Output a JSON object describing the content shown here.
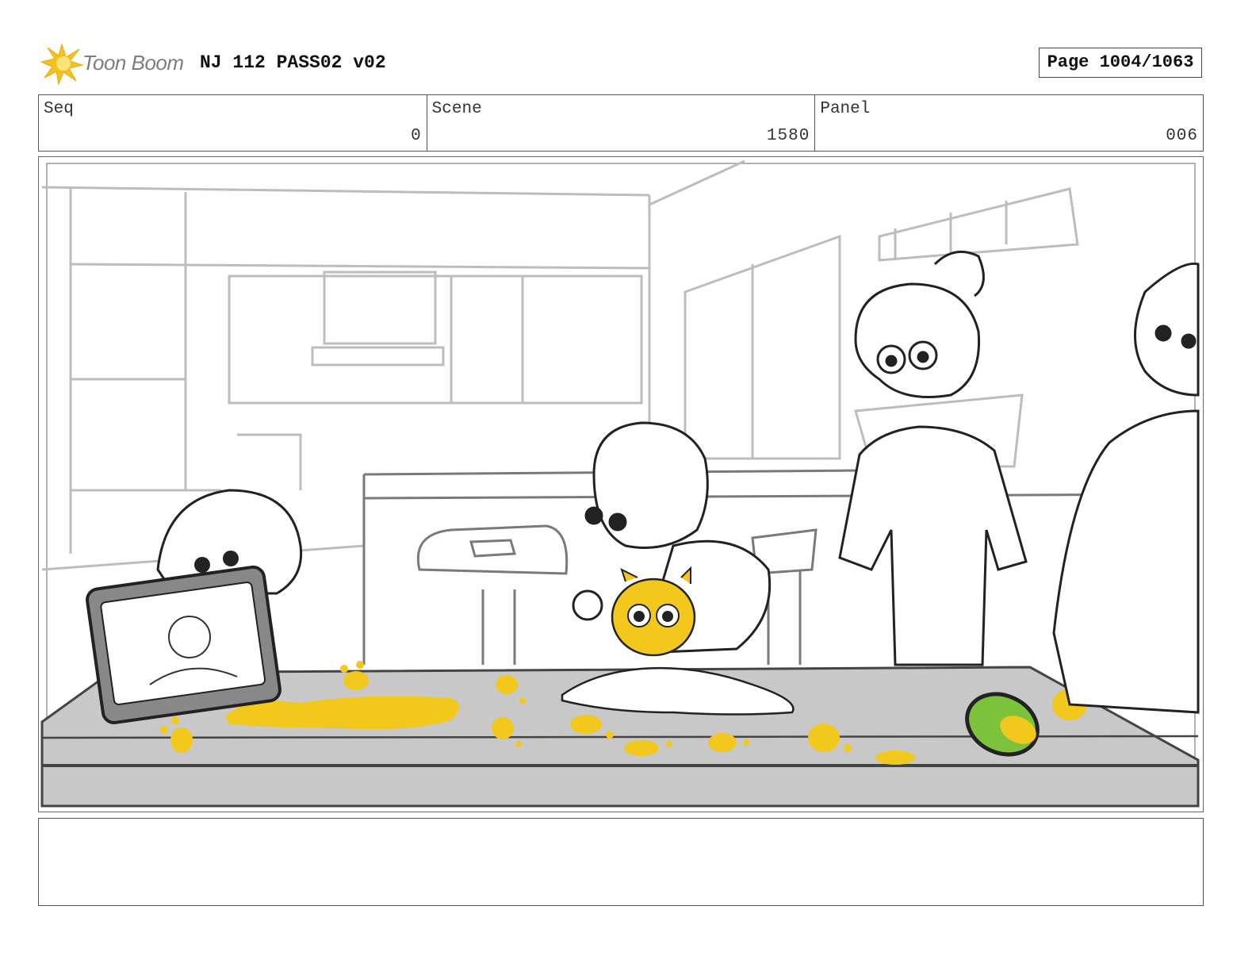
{
  "header": {
    "logo_text": "Toon Boom",
    "title": "NJ 112 PASS02 v02",
    "page": "Page 1004/1063"
  },
  "info": {
    "seq_label": "Seq",
    "seq_value": "0",
    "scene_label": "Scene",
    "scene_value": "1580",
    "panel_label": "Panel",
    "panel_value": "006"
  },
  "colors": {
    "accent_yellow": "#f2c81c",
    "table_gray": "#c9c9c9",
    "mango_green": "#7cc23a"
  },
  "notes": ""
}
